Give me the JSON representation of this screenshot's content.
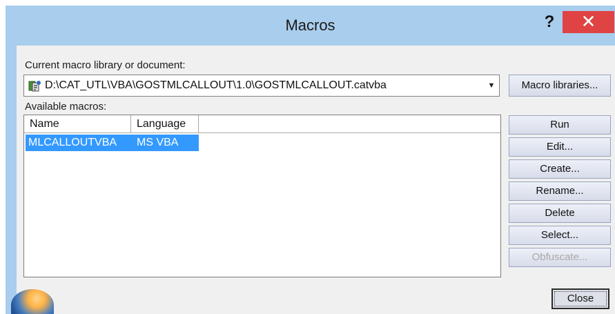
{
  "window": {
    "title": "Macros",
    "help_label": "?",
    "close_label": "✕"
  },
  "library": {
    "label": "Current macro library or document:",
    "path": "D:\\CAT_UTL\\VBA\\GOSTMLCALLOUT\\1.0\\GOSTMLCALLOUT.catvba",
    "dropdown_arrow": "▼",
    "macro_libraries_button": "Macro libraries..."
  },
  "macros": {
    "label": "Available macros:",
    "columns": [
      "Name",
      "Language"
    ],
    "rows": [
      {
        "name": "MLCALLOUTVBA",
        "language": "MS VBA",
        "selected": true
      }
    ]
  },
  "actions": {
    "run": "Run",
    "edit": "Edit...",
    "create": "Create...",
    "rename": "Rename...",
    "delete": "Delete",
    "select": "Select...",
    "obfuscate": "Obfuscate...",
    "close": "Close"
  },
  "icons": {
    "library": "vba-library-icon",
    "corner_logo": "catia-logo-icon"
  },
  "colors": {
    "selection": "#3399ff",
    "close_red": "#e04343",
    "frame": "#a9cdec"
  }
}
